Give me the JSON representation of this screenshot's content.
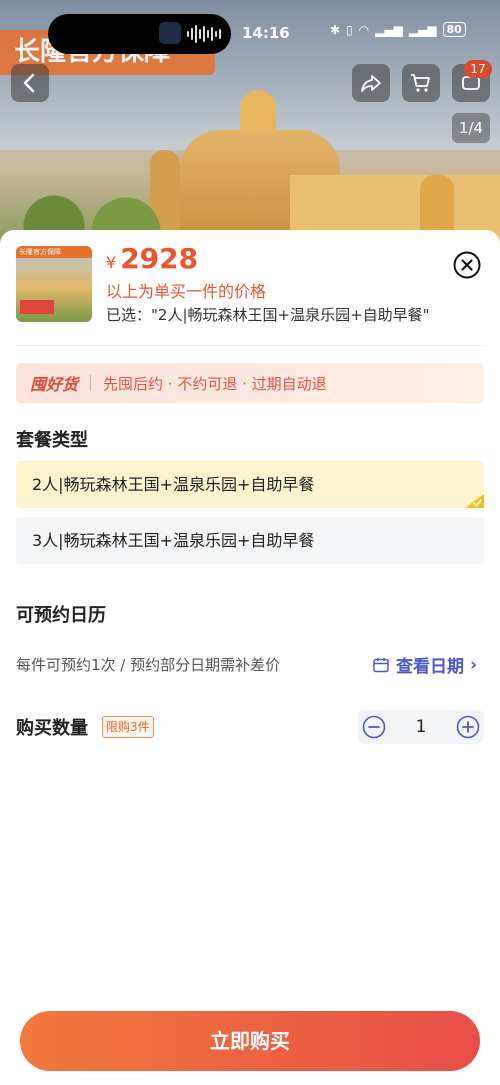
{
  "status_bar": {
    "time": "14:16",
    "battery": "80"
  },
  "hero": {
    "banner_text": "长隆官方保障",
    "cart_badge": "17",
    "image_counter": "1/4"
  },
  "product": {
    "price_symbol": "¥",
    "price": "2928",
    "price_note": "以上为单买一件的价格",
    "selected_text": "已选：\"2人|畅玩森林王国+温泉乐园+自助早餐\"",
    "thumb_label": "长隆官方保障"
  },
  "promo": {
    "logo": "囤好货",
    "text": "先囤后约 · 不约可退 · 过期自动退"
  },
  "package": {
    "title": "套餐类型",
    "options": [
      {
        "label": "2人|畅玩森林王国+温泉乐园+自助早餐",
        "selected": true
      },
      {
        "label": "3人|畅玩森林王国+温泉乐园+自助早餐",
        "selected": false
      }
    ]
  },
  "calendar": {
    "title": "可预约日历",
    "note": "每件可预约1次 / 预约部分日期需补差价",
    "view_label": "查看日期"
  },
  "quantity": {
    "label": "购买数量",
    "limit": "限购3件",
    "value": "1"
  },
  "footer": {
    "buy_label": "立即购买"
  },
  "colors": {
    "accent": "#e8552e",
    "link": "#4f57c8",
    "selected_bg": "#fdf4cf"
  }
}
